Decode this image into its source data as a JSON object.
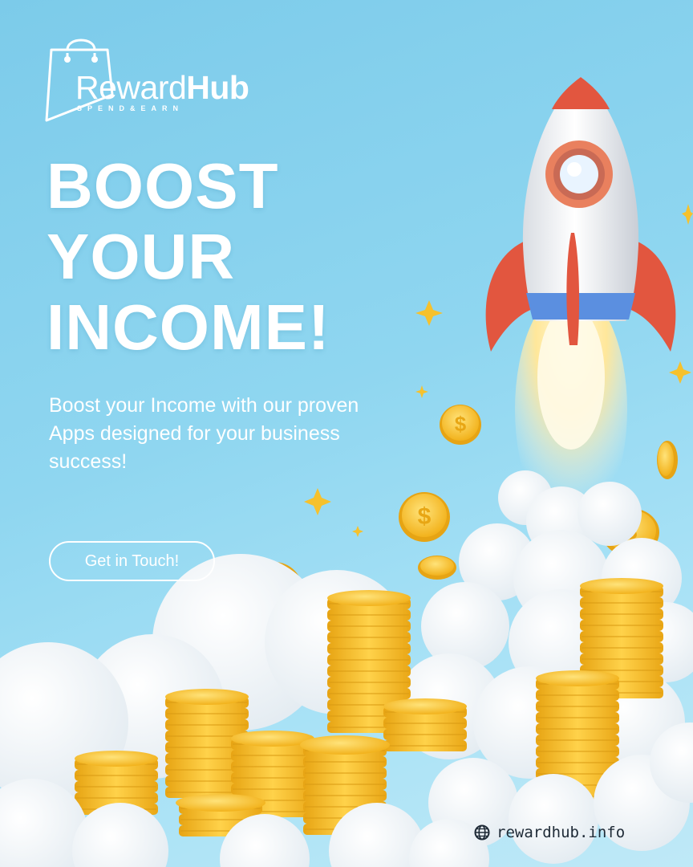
{
  "brand": {
    "name_light": "Reward",
    "name_bold": "Hub",
    "tagline": "SPEND&EARN"
  },
  "headline": {
    "line1": "BOOST",
    "line2": "YOUR",
    "line3": "INCOME!"
  },
  "subtext": "Boost your Income with our proven Apps designed for your business success!",
  "cta": {
    "label": "Get in Touch!"
  },
  "footer": {
    "website": "rewardhub.info",
    "icon": "globe-icon"
  },
  "colors": {
    "background": "#8fd6f0",
    "text": "#ffffff",
    "coin": "#f6c12c",
    "rocket_accent": "#e2563f"
  }
}
